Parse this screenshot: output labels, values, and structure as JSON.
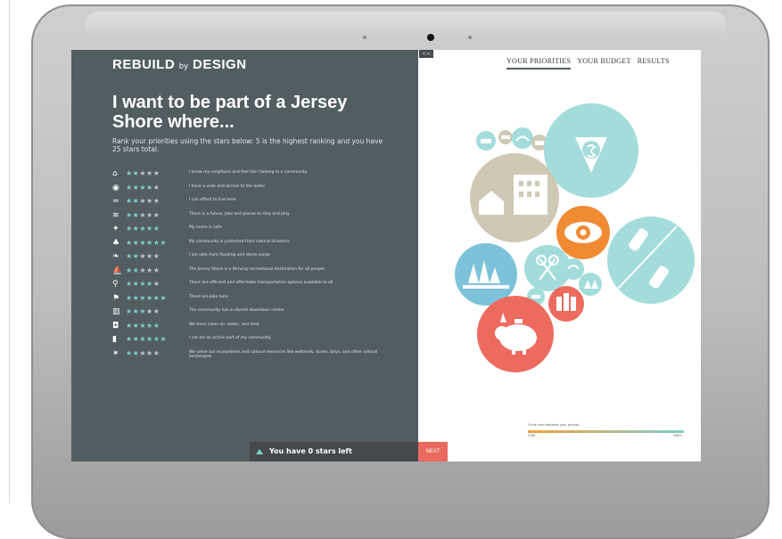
{
  "brand": {
    "name": "REBUILD",
    "by": "by",
    "design": "DESIGN"
  },
  "headline": "I want to be part of a Jersey Shore where...",
  "instructions": "Rank your priorities using the stars below: 5 is the highest ranking and you have 25 stars total.",
  "tabs": [
    {
      "label": "YOUR PRIORITIES",
      "active": true
    },
    {
      "label": "YOUR BUDGET",
      "active": false
    },
    {
      "label": "RESULTS",
      "active": false
    }
  ],
  "priorities": [
    {
      "icon": "house-icon",
      "stars": 2,
      "max": 5,
      "text": "I know my neighbors and feel like I belong to a community"
    },
    {
      "icon": "eye-icon",
      "stars": 4,
      "max": 5,
      "text": "I have a view and access to the water"
    },
    {
      "icon": "wave-icon",
      "stars": 2,
      "max": 5,
      "text": "I can afford to live here"
    },
    {
      "icon": "flood-icon",
      "stars": 2,
      "max": 5,
      "text": "There is a future, jobs and places to stay and play"
    },
    {
      "icon": "bird-icon",
      "stars": 5,
      "max": 5,
      "text": "My home is safe"
    },
    {
      "icon": "tree-icon",
      "stars": 6,
      "max": 6,
      "text": "My community is protected from natural disasters"
    },
    {
      "icon": "leaf-icon",
      "stars": 2,
      "max": 5,
      "text": "I am safe from flooding and storm surge"
    },
    {
      "icon": "boat-icon",
      "stars": 2,
      "max": 5,
      "text": "The Jersey Shore is a thriving recreational destination for all people"
    },
    {
      "icon": "bike-icon",
      "stars": 4,
      "max": 5,
      "text": "There are efficient and affordable transportation options available to all"
    },
    {
      "icon": "wind-icon",
      "stars": 6,
      "max": 6,
      "text": "There are jobs here"
    },
    {
      "icon": "building-icon",
      "stars": 3,
      "max": 5,
      "text": "The community has a vibrant downtown center"
    },
    {
      "icon": "car-icon",
      "stars": 5,
      "max": 5,
      "text": "We have clean air, water, and land"
    },
    {
      "icon": "chart-icon",
      "stars": 6,
      "max": 6,
      "text": "I can be an active part of my community"
    },
    {
      "icon": "fish-icon",
      "stars": 2,
      "max": 5,
      "text": "We value our ecosystems and natural resources like wetlands, dunes, bays, and other natural landscapes"
    }
  ],
  "footer": {
    "stars_left": "You have 0 stars left",
    "next": "NEXT"
  },
  "collapse_label": "<<",
  "scale": {
    "label": "Circle size indicates your priority",
    "low": "LOW",
    "high": "HIGH"
  },
  "colors": {
    "panel": "#525d62",
    "teal": "#a3dcdb",
    "beige": "#cfc8b4",
    "orange": "#f08a33",
    "coral": "#ec6b5e",
    "blue": "#7cc3da"
  }
}
